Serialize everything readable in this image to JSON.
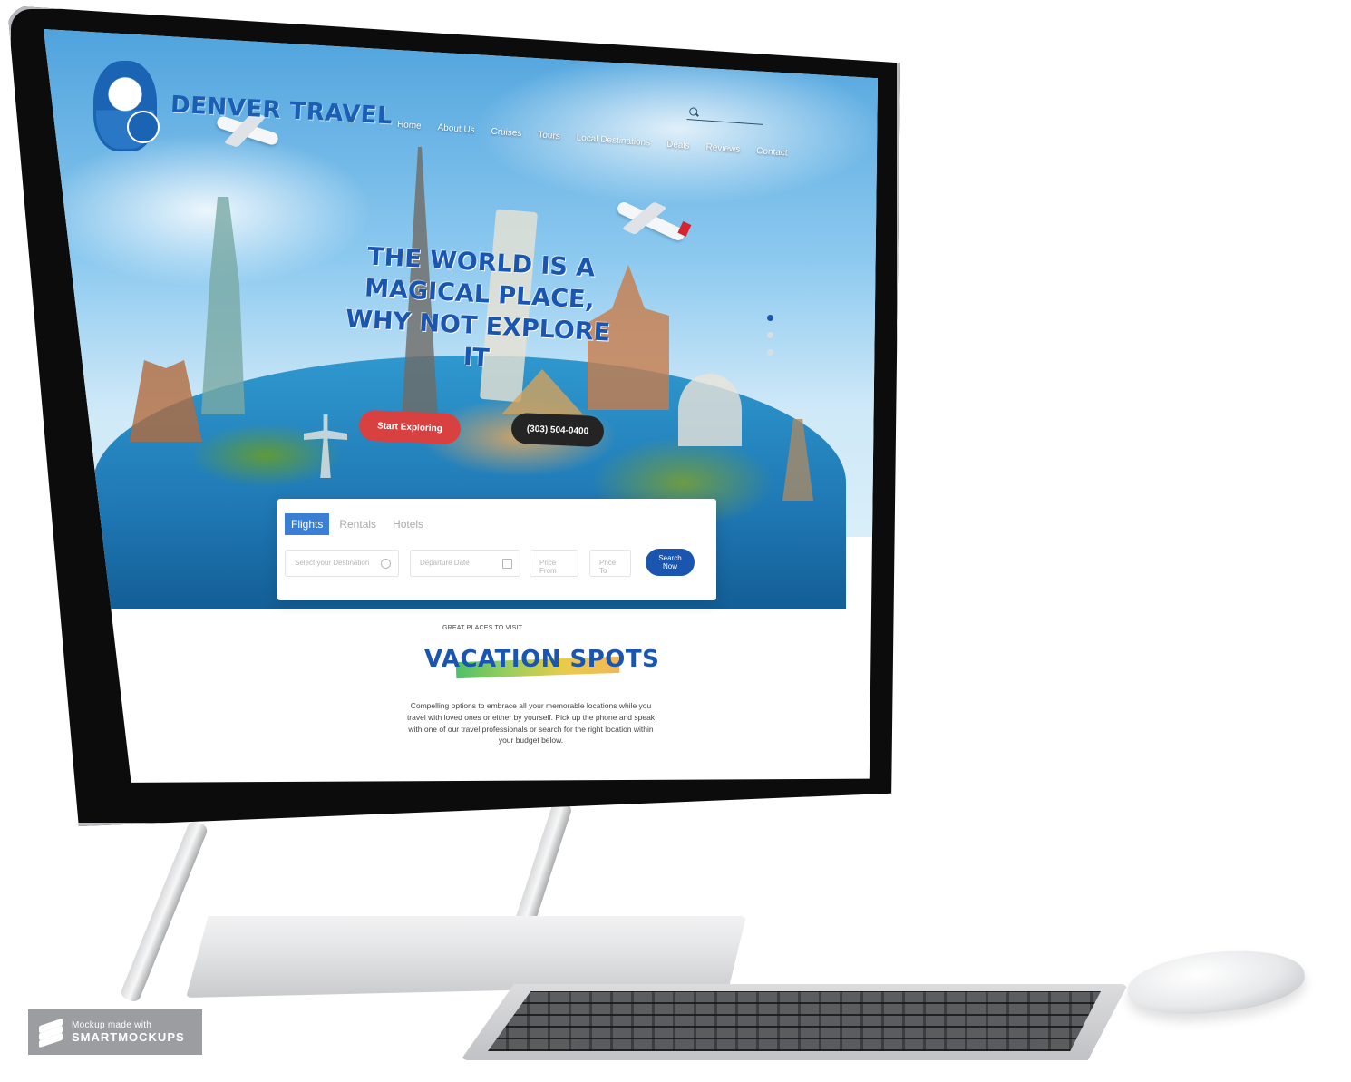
{
  "site": {
    "brand": "DENVER TRAVEL",
    "nav": [
      "Home",
      "About Us",
      "Cruises",
      "Tours",
      "Local Destinations",
      "Deals",
      "Reviews",
      "Contact"
    ],
    "search": {
      "placeholder": ""
    }
  },
  "hero": {
    "headline": "THE WORLD IS A MAGICAL PLACE, WHY NOT EXPLORE IT",
    "cta_primary": "Start Exploring",
    "cta_phone": "(303) 504-0400",
    "slides": 3,
    "active_slide": 1
  },
  "booking": {
    "tabs": [
      "Flights",
      "Rentals",
      "Hotels"
    ],
    "active_tab": "Flights",
    "destination_placeholder": "Select your Destination",
    "date_placeholder": "Departure Date",
    "price_from_placeholder": "Price From",
    "price_to_placeholder": "Price To",
    "search_label": "Search Now"
  },
  "vacation": {
    "eyebrow": "GREAT PLACES TO VISIT",
    "title": "VACATION SPOTS",
    "description": "Compelling options to embrace all your memorable locations while you travel with loved ones or either by yourself. Pick up the phone and speak with one of our travel professionals or search for the right location within your budget below."
  },
  "mockup_badge": {
    "line1": "Mockup made with",
    "line2": "SMARTMOCKUPS"
  },
  "colors": {
    "brand_blue": "#1a56b0",
    "cta_red": "#d94040",
    "phone_dark": "#242424",
    "tab_active": "#3b7fd4"
  }
}
